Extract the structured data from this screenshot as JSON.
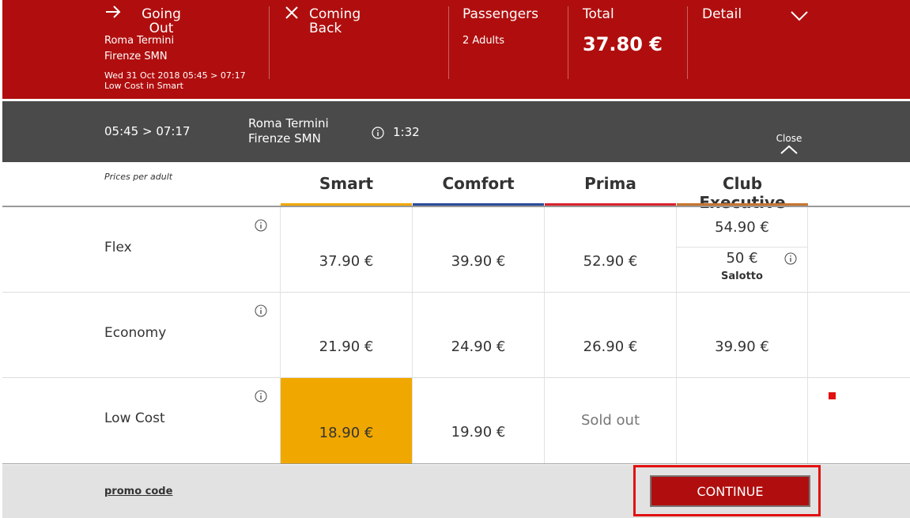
{
  "summary": {
    "going_out": {
      "label_line1": "Going",
      "label_line2": "Out",
      "from": "Roma Termini",
      "to": "Firenze SMN",
      "datetime": "Wed 31 Oct 2018 05:45 > 07:17",
      "fare": "Low Cost in Smart"
    },
    "coming_back": {
      "label_line1": "Coming",
      "label_line2": "Back"
    },
    "passengers": {
      "label": "Passengers",
      "value": "2 Adults"
    },
    "total": {
      "label": "Total",
      "value": "37.80 €"
    },
    "detail": {
      "label": "Detail"
    }
  },
  "train": {
    "times": "05:45 > 07:17",
    "from": "Roma Termini",
    "to": "Firenze SMN",
    "duration": "1:32",
    "close_label": "Close"
  },
  "table": {
    "prices_per": "Prices per adult",
    "columns": [
      {
        "name": "Smart",
        "color": "#f0a800"
      },
      {
        "name": "Comfort",
        "color": "#2b4c9b"
      },
      {
        "name": "Prima",
        "color": "#d9232e"
      },
      {
        "name": "Club Executive",
        "color": "#c87530"
      }
    ],
    "rows": [
      {
        "label": "Flex",
        "prices": [
          "37.90 €",
          "39.90 €",
          "52.90 €"
        ],
        "club_price": "54.90 €",
        "club_salotto_price": "50 €",
        "club_salotto_label": "Salotto"
      },
      {
        "label": "Economy",
        "prices": [
          "21.90 €",
          "24.90 €",
          "26.90 €",
          "39.90 €"
        ]
      },
      {
        "label": "Low Cost",
        "prices": [
          "18.90 €",
          "19.90 €",
          "Sold out",
          ""
        ]
      }
    ]
  },
  "footer": {
    "promo_label": "promo code",
    "continue_label": "CONTINUE"
  },
  "colors": {
    "brand_red": "#b00e0e",
    "dark_bar": "#4a4a4a",
    "selected": "#f0a800",
    "highlight_outline": "#e21010"
  }
}
